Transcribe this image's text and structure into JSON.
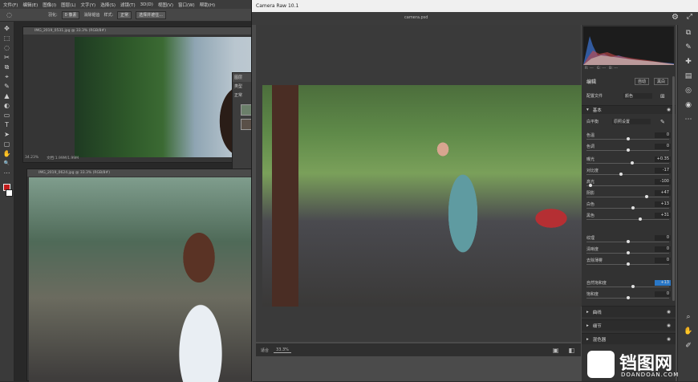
{
  "ps": {
    "menu": [
      "文件(F)",
      "编辑(E)",
      "图像(I)",
      "图层(L)",
      "文字(Y)",
      "选择(S)",
      "滤镜(T)",
      "3D(D)",
      "视图(V)",
      "窗口(W)",
      "帮助(H)"
    ],
    "options": {
      "feather": "羽化:",
      "feather_value": "0 像素",
      "antialias": "消除锯齿",
      "style": "样式:",
      "style_value": "正常",
      "select_mask": "选择并遮住..."
    },
    "doc1": {
      "tab": "IMG_2019_0531.jpg @ 33.3% (RGB/8#)",
      "zoom": "34.23%",
      "status": "文档:1.99M/1.99M"
    },
    "doc2": {
      "tab": "IMG_2019_0624.jpg @ 33.3% (RGB/8#)"
    },
    "layers": {
      "label": "图层",
      "kind": "类型",
      "normal": "正常"
    },
    "tools": [
      "✥",
      "⬚",
      "◌",
      "✂",
      "⧉",
      "⌖",
      "✎",
      "▲",
      "◐",
      "▭",
      "T",
      "➤",
      "▢",
      "✋",
      "🔍",
      "⋯"
    ]
  },
  "cr": {
    "title": "Camera Raw 10.1",
    "filename": "camera.psd",
    "bottom": {
      "zoom_label": "适合",
      "zoom_value": "33.3%"
    },
    "histogram_info": {
      "r": "R: ---",
      "g": "G: ---",
      "b": "B: ---",
      "meta": "f/5.6  1/200秒  ISO 100  35 毫米"
    },
    "panel": {
      "edit": "编辑",
      "auto": "自动",
      "bw": "黑白",
      "profile_label": "配置文件",
      "profile_value": "颜色",
      "basic": "基本",
      "wb_label": "白平衡",
      "wb_value": "原照设置",
      "sliders": [
        {
          "label": "色温",
          "value": "0",
          "pos": 0.5
        },
        {
          "label": "色调",
          "value": "0",
          "pos": 0.5
        },
        {
          "label": "曝光",
          "value": "+0.35",
          "pos": 0.55
        },
        {
          "label": "对比度",
          "value": "-17",
          "pos": 0.42
        },
        {
          "label": "高光",
          "value": "-100",
          "pos": 0.05
        },
        {
          "label": "阴影",
          "value": "+47",
          "pos": 0.73
        },
        {
          "label": "白色",
          "value": "+13",
          "pos": 0.56
        },
        {
          "label": "黑色",
          "value": "+31",
          "pos": 0.65
        },
        {
          "label": "纹理",
          "value": "0",
          "pos": 0.5
        },
        {
          "label": "清晰度",
          "value": "0",
          "pos": 0.5
        },
        {
          "label": "去除薄雾",
          "value": "0",
          "pos": 0.5
        },
        {
          "label": "自然饱和度",
          "value": "+13",
          "pos": 0.56
        },
        {
          "label": "饱和度",
          "value": "0",
          "pos": 0.5
        }
      ],
      "sections": [
        "曲线",
        "细节",
        "混色器"
      ]
    },
    "right_icons": [
      "crop-icon",
      "brush-icon",
      "heal-icon",
      "radial-icon",
      "graduated-icon",
      "redeye-icon",
      "preset-icon",
      "zoom-icon",
      "hand-icon",
      "sampler-icon"
    ]
  },
  "watermark": {
    "brand": "铛图网",
    "url": "DOANDOAN.COM"
  },
  "colors": {
    "accent": "#2a78c8",
    "histogram_red": "#c44",
    "histogram_blue": "#37c"
  }
}
